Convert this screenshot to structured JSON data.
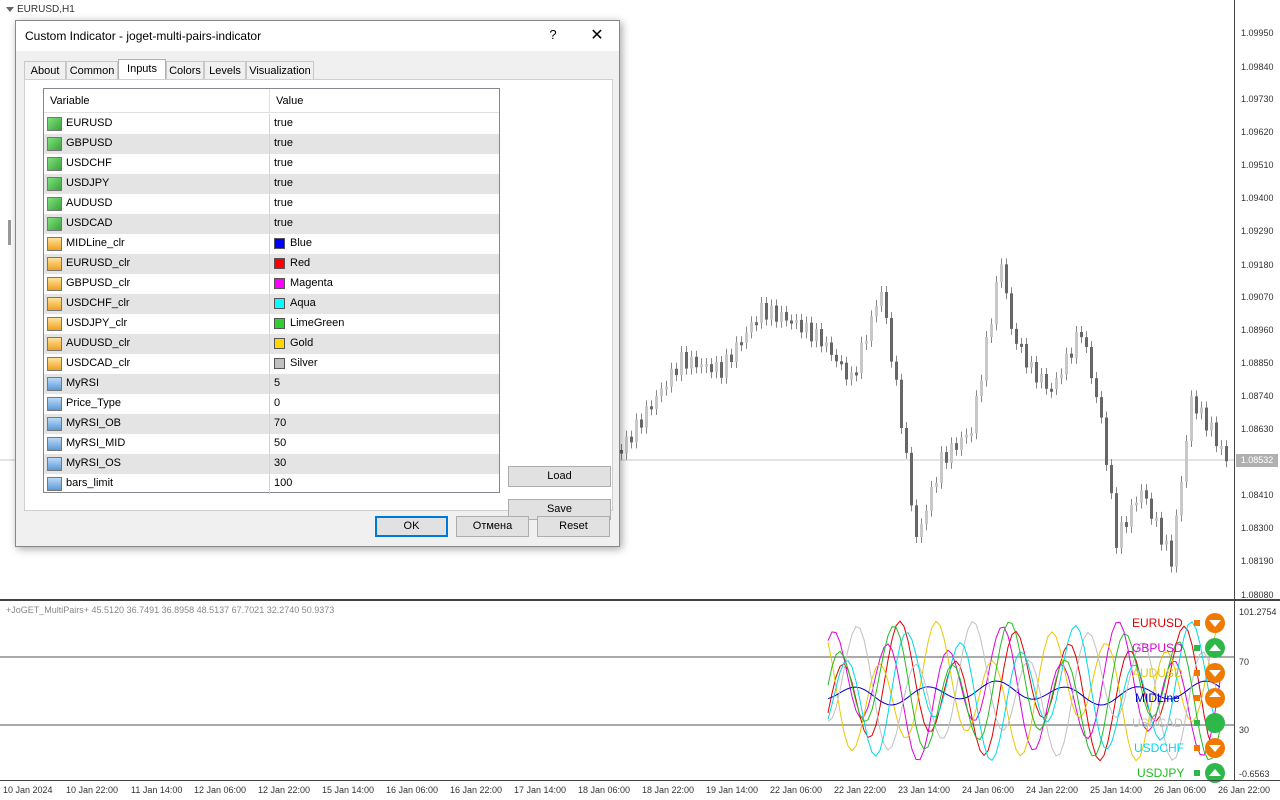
{
  "chart": {
    "title": "EURUSD,H1",
    "price_labels": [
      "1.09950",
      "1.09840",
      "1.09730",
      "1.09620",
      "1.09510",
      "1.09400",
      "1.09290",
      "1.09180",
      "1.09070",
      "1.08960",
      "1.08850",
      "1.08740",
      "1.08630",
      "1.08410",
      "1.08300",
      "1.08190",
      "1.08080"
    ],
    "current_price": "1.08532",
    "indicator_info": "+JoGET_MultiPairs+ 45.5120 36.7491 36.8958 48.5137 67.7021 32.2740 50.9373",
    "indicator_levels": [
      "101.2754",
      "70",
      "30",
      "-0.6563"
    ],
    "time_labels": [
      "10 Jan 2024",
      "10 Jan 22:00",
      "11 Jan 14:00",
      "12 Jan 06:00",
      "12 Jan 22:00",
      "15 Jan 14:00",
      "16 Jan 06:00",
      "16 Jan 22:00",
      "17 Jan 14:00",
      "18 Jan 06:00",
      "18 Jan 22:00",
      "19 Jan 14:00",
      "22 Jan 06:00",
      "22 Jan 22:00",
      "23 Jan 14:00",
      "24 Jan 06:00",
      "24 Jan 22:00",
      "25 Jan 14:00",
      "26 Jan 06:00",
      "26 Jan 22:00"
    ],
    "pairs": [
      {
        "label": "EURUSD",
        "color": "#dd0000",
        "signal": "down-arrow",
        "circle": "#f07a00"
      },
      {
        "label": "GBPUSD",
        "color": "#dd00dd",
        "signal": "up-arrow",
        "circle": "#2fb84a"
      },
      {
        "label": "AUDUSD",
        "color": "#e8c800",
        "signal": "down-arrow",
        "circle": "#f07a00"
      },
      {
        "label": "MIDLine",
        "color": "#0000cc",
        "signal": "up-down-arrow",
        "circle": "#f07a00"
      },
      {
        "label": "USDCAD",
        "color": "#c0c0c0",
        "signal": "dot",
        "circle": "#2fb84a"
      },
      {
        "label": "USDCHF",
        "color": "#00d8e8",
        "signal": "down-arrow",
        "circle": "#f07a00"
      },
      {
        "label": "USDJPY",
        "color": "#22bb22",
        "signal": "up-arrow",
        "circle": "#2fb84a"
      }
    ]
  },
  "dialog": {
    "title": "Custom Indicator - joget-multi-pairs-indicator",
    "help": "?",
    "close": "✕",
    "tabs": [
      "About",
      "Common",
      "Inputs",
      "Colors",
      "Levels",
      "Visualization"
    ],
    "active_tab": "Inputs",
    "columns": {
      "variable": "Variable",
      "value": "Value"
    },
    "rows": [
      {
        "name": "EURUSD",
        "value": "true",
        "type": "bool"
      },
      {
        "name": "GBPUSD",
        "value": "true",
        "type": "bool"
      },
      {
        "name": "USDCHF",
        "value": "true",
        "type": "bool"
      },
      {
        "name": "USDJPY",
        "value": "true",
        "type": "bool"
      },
      {
        "name": "AUDUSD",
        "value": "true",
        "type": "bool"
      },
      {
        "name": "USDCAD",
        "value": "true",
        "type": "bool"
      },
      {
        "name": "MIDLine_clr",
        "value": "Blue",
        "type": "color",
        "swatch": "#0000ff"
      },
      {
        "name": "EURUSD_clr",
        "value": "Red",
        "type": "color",
        "swatch": "#ff0000"
      },
      {
        "name": "GBPUSD_clr",
        "value": "Magenta",
        "type": "color",
        "swatch": "#ff00ff"
      },
      {
        "name": "USDCHF_clr",
        "value": "Aqua",
        "type": "color",
        "swatch": "#00ffff"
      },
      {
        "name": "USDJPY_clr",
        "value": "LimeGreen",
        "type": "color",
        "swatch": "#32cd32"
      },
      {
        "name": "AUDUSD_clr",
        "value": "Gold",
        "type": "color",
        "swatch": "#ffd700"
      },
      {
        "name": "USDCAD_clr",
        "value": "Silver",
        "type": "color",
        "swatch": "#c0c0c0"
      },
      {
        "name": "MyRSI",
        "value": "5",
        "type": "num"
      },
      {
        "name": "Price_Type",
        "value": "0",
        "type": "num"
      },
      {
        "name": "MyRSI_OB",
        "value": "70",
        "type": "num"
      },
      {
        "name": "MyRSI_MID",
        "value": "50",
        "type": "num"
      },
      {
        "name": "MyRSI_OS",
        "value": "30",
        "type": "num"
      },
      {
        "name": "bars_limit",
        "value": "100",
        "type": "num"
      }
    ],
    "buttons": {
      "load": "Load",
      "save": "Save",
      "ok": "OK",
      "cancel": "Отмена",
      "reset": "Reset"
    }
  }
}
